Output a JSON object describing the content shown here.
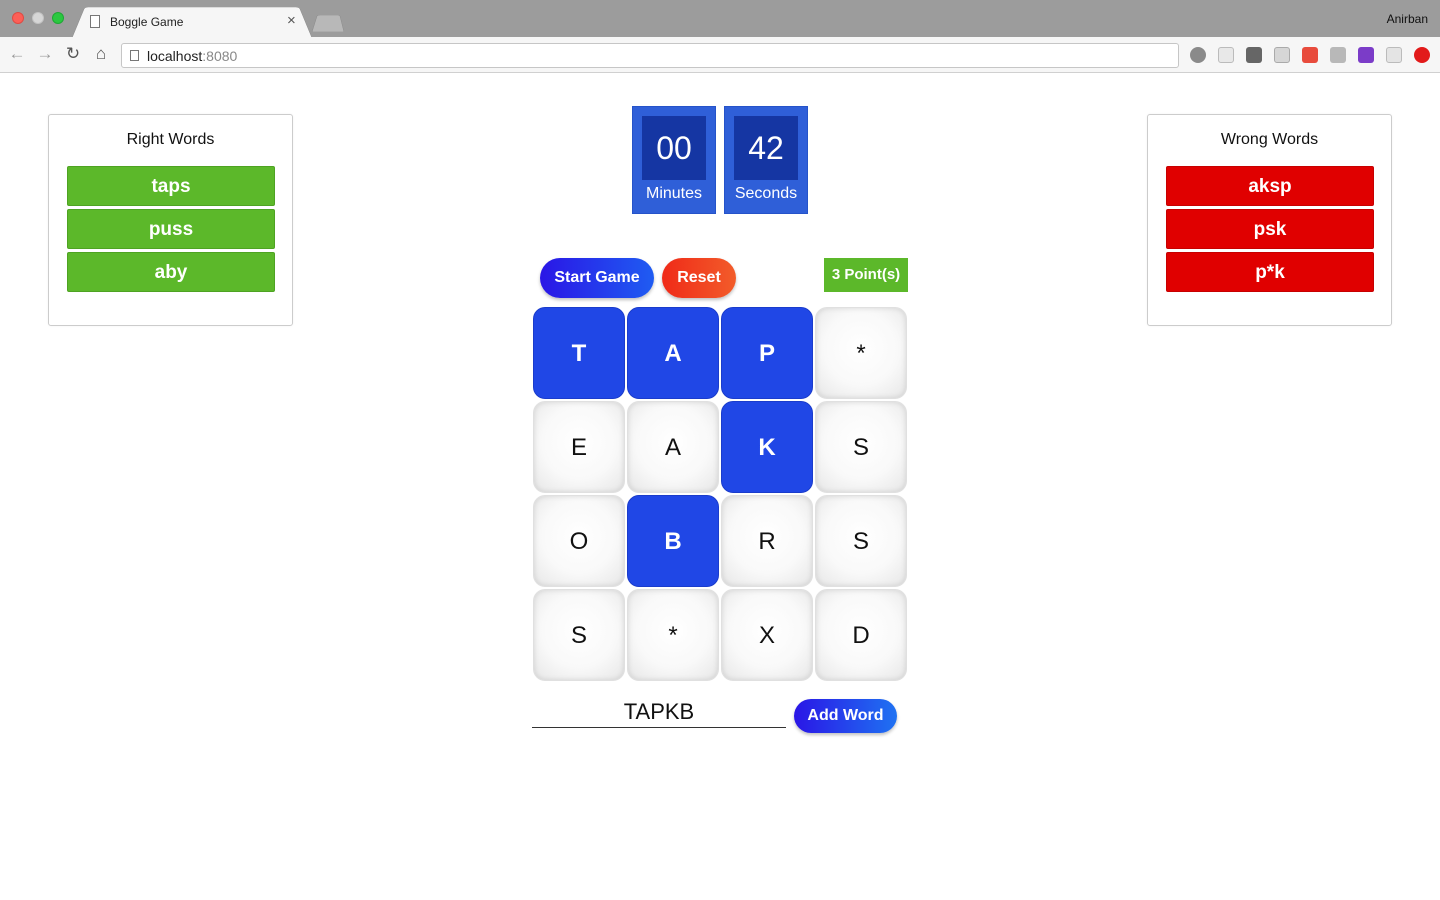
{
  "browser": {
    "tab_title": "Boggle Game",
    "tab_close": "×",
    "user_name": "Anirban",
    "url_host": "localhost",
    "url_port": ":8080",
    "nav": {
      "back": "←",
      "forward": "→",
      "reload": "↻",
      "home": "⌂"
    }
  },
  "timer": {
    "minutes": "00",
    "minutes_label": "Minutes",
    "seconds": "42",
    "seconds_label": "Seconds"
  },
  "controls": {
    "start_label": "Start Game",
    "reset_label": "Reset",
    "score_label": "3 Point(s)",
    "add_label": "Add Word"
  },
  "right_panel": {
    "title": "Right Words",
    "words": [
      "taps",
      "puss",
      "aby"
    ]
  },
  "wrong_panel": {
    "title": "Wrong Words",
    "words": [
      "aksp",
      "psk",
      "p*k"
    ]
  },
  "board": {
    "cells": [
      "T",
      "A",
      "P",
      "*",
      "E",
      "A",
      "K",
      "S",
      "O",
      "B",
      "R",
      "S",
      "S",
      "*",
      "X",
      "D"
    ],
    "selected": [
      0,
      1,
      2,
      6,
      9
    ]
  },
  "input": {
    "value": "TAPKB"
  },
  "colors": {
    "accent_blue": "#2047e6",
    "right_green": "#5cb82a",
    "wrong_red": "#e00000",
    "timer_blue": "#2f5fd8",
    "timer_dark": "#1536a3"
  }
}
